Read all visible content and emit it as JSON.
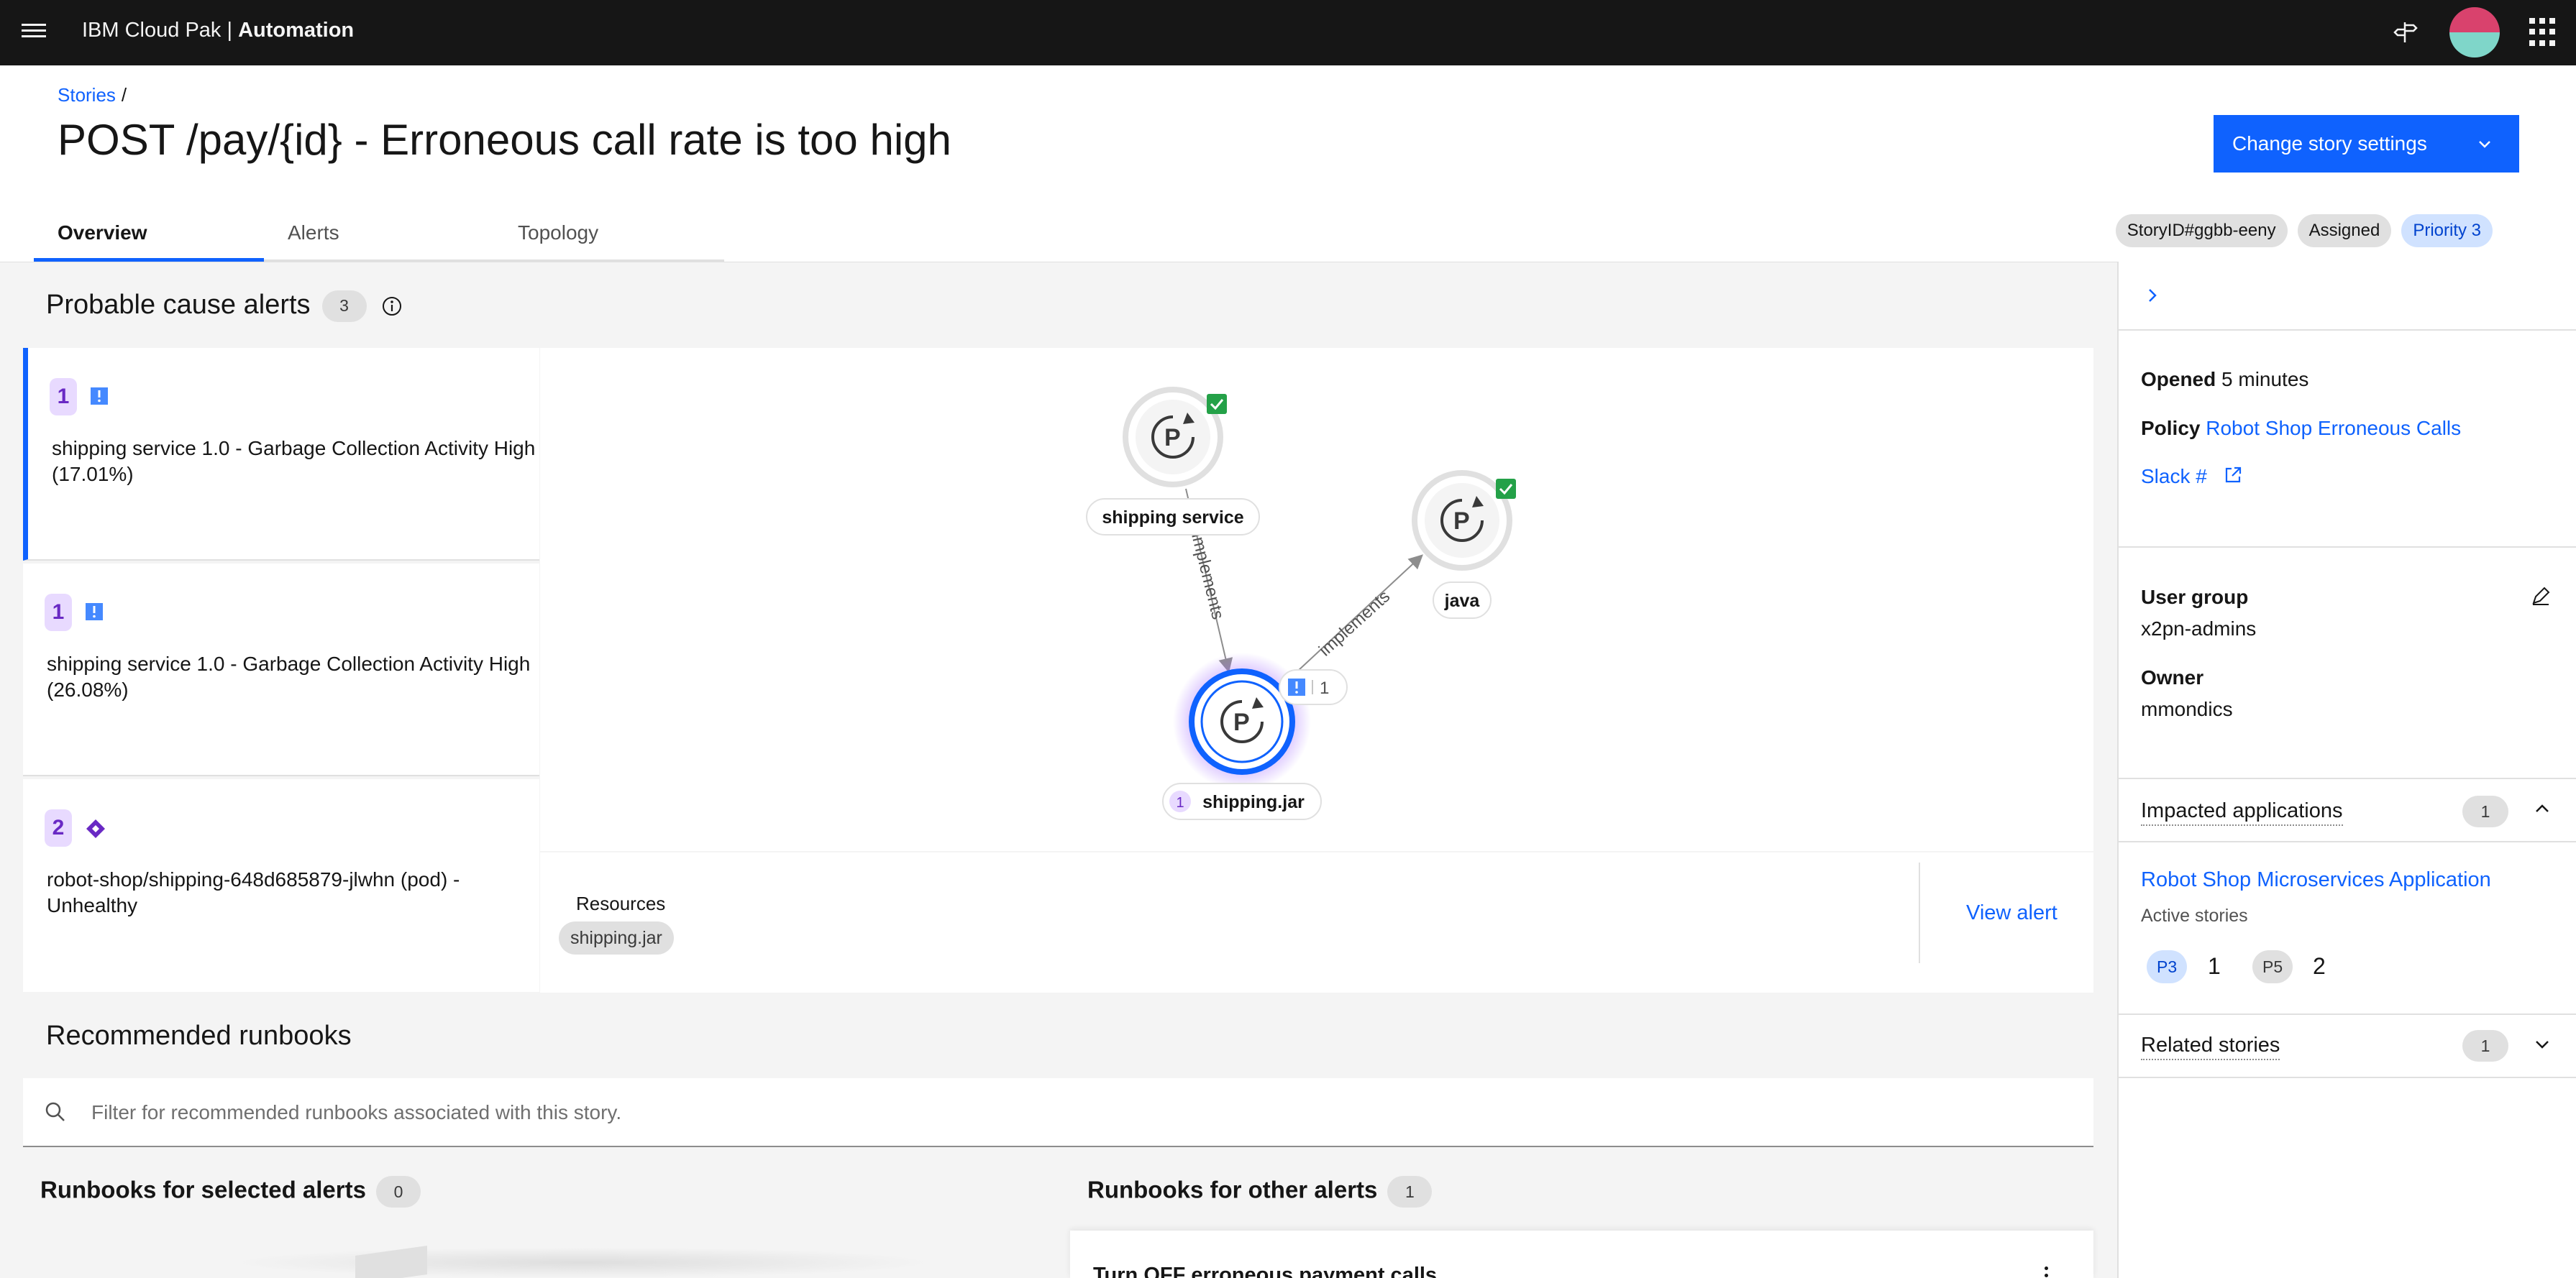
{
  "header": {
    "brand_prefix": "IBM Cloud Pak | ",
    "brand_product": "Automation",
    "icons": [
      "menu-icon",
      "signpost-icon",
      "avatar",
      "app-switcher-icon"
    ]
  },
  "breadcrumb": {
    "root": "Stories",
    "separator": "/"
  },
  "page": {
    "title": "POST /pay/{id} - Erroneous call rate is too high",
    "change_button": "Change story settings"
  },
  "tabs": [
    {
      "label": "Overview",
      "active": true
    },
    {
      "label": "Alerts",
      "active": false
    },
    {
      "label": "Topology",
      "active": false
    }
  ],
  "tags": {
    "story_id": "StoryID#ggbb-eeny",
    "status": "Assigned",
    "priority": "Priority 3"
  },
  "probable_cause": {
    "title": "Probable cause alerts",
    "count": "3",
    "alerts": [
      {
        "rank": "1",
        "icon": "critical-square-icon",
        "text": "shipping service 1.0 - Garbage Collection Activity High (17.01%)",
        "selected": true
      },
      {
        "rank": "1",
        "icon": "critical-square-icon",
        "text": "shipping service 1.0 - Garbage Collection Activity High (26.08%)",
        "selected": false
      },
      {
        "rank": "2",
        "icon": "major-diamond-icon",
        "text": "robot-shop/shipping-648d685879-jlwhn (pod) - Unhealthy",
        "selected": false
      }
    ]
  },
  "topology": {
    "nodes": [
      {
        "label": "shipping service",
        "status": "ok"
      },
      {
        "label": "java",
        "status": "ok"
      },
      {
        "label": "shipping.jar",
        "badge": "1",
        "alert_count": "1"
      }
    ],
    "edges": [
      {
        "from": "shipping service",
        "to": "shipping.jar",
        "label": "implements"
      },
      {
        "from": "shipping.jar",
        "to": "java",
        "label": "implements"
      }
    ]
  },
  "resources": {
    "label": "Resources",
    "items": [
      "shipping.jar"
    ],
    "view_alert": "View alert"
  },
  "runbooks": {
    "title": "Recommended runbooks",
    "search_placeholder": "Filter for recommended runbooks associated with this story.",
    "selected_title": "Runbooks for selected alerts",
    "selected_count": "0",
    "other_title": "Runbooks for other alerts",
    "other_count": "1",
    "other_items": [
      "Turn OFF erroneous payment calls"
    ]
  },
  "side_panel": {
    "opened_label": "Opened",
    "opened_value": "5 minutes",
    "policy_label": "Policy",
    "policy_value": "Robot Shop Erroneous Calls",
    "slack_label": "Slack #",
    "user_group_label": "User group",
    "user_group_value": "x2pn-admins",
    "owner_label": "Owner",
    "owner_value": "mmondics",
    "impacted_title": "Impacted applications",
    "impacted_count": "1",
    "app_name": "Robot Shop Microservices Application",
    "active_stories_label": "Active stories",
    "p3_label": "P3",
    "p3_count": "1",
    "p5_label": "P5",
    "p5_count": "2",
    "related_title": "Related stories",
    "related_count": "1"
  },
  "colors": {
    "accent": "#0f62fe",
    "header_bg": "#161616",
    "severity_purple": "#6929c4",
    "ok_green": "#24a148"
  }
}
